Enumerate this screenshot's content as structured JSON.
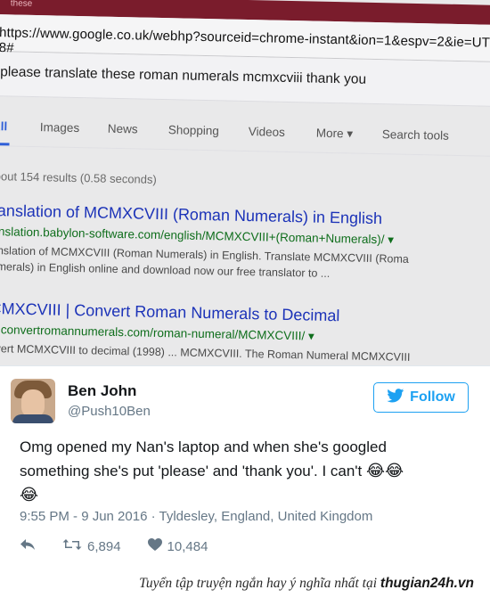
{
  "browser": {
    "tab_text": "these",
    "url": "https://www.google.co.uk/webhp?sourceid=chrome-instant&ion=1&espv=2&ie=UTF-8#",
    "query": "please translate these roman numerals mcmxcviii thank you",
    "nav_tabs": [
      "All",
      "Images",
      "News",
      "Shopping",
      "Videos",
      "More ▾",
      "Search tools"
    ],
    "stats": "bout 154 results (0.58 seconds)"
  },
  "results": [
    {
      "title": "ranslation of MCMXCVIII (Roman Numerals) in English",
      "url": "anslation.babylon-software.com/english/MCMXCVIII+(Roman+Numerals)/ ▾",
      "snippet_1": "anslation of MCMXCVIII (Roman Numerals) in English. Translate MCMXCVIII (Roma",
      "snippet_2": "umerals) in English online and download now our free translator to ..."
    },
    {
      "title": "CMXCVIII | Convert Roman Numerals to Decimal",
      "url": "w.convertromannumerals.com/roman-numeral/MCMXCVIII/ ▾",
      "snippet_1": "nvert MCMXCVIII to decimal (1998) ... MCMXCVIII. The Roman Numeral MCMXCVIII"
    }
  ],
  "tweet": {
    "display_name": "Ben John",
    "handle": "@Push10Ben",
    "follow_label": "Follow",
    "text_line_1": "Omg opened my Nan's laptop and when she's googled",
    "text_line_2": "something she's put 'please' and 'thank you'. I can't",
    "emoji": "😂",
    "meta": "9:55 PM - 9 Jun 2016 · Tyldesley, England, United Kingdom",
    "retweets": "6,894",
    "likes": "10,484"
  },
  "footer": {
    "caption": "Tuyển tập truyện ngắn hay ý nghĩa nhất tại",
    "brand": "thugian24h.vn"
  },
  "colors": {
    "twitter_blue": "#1da1f2",
    "link_blue": "#1c33b8",
    "url_green": "#0f6e1c"
  }
}
